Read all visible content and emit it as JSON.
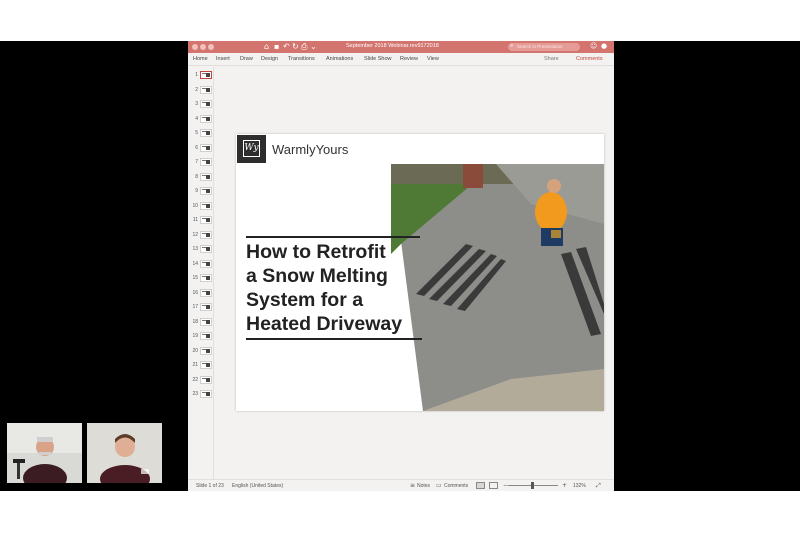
{
  "window": {
    "title": "September 2018 Webinar.rev9172018",
    "search_placeholder": "Search in Presentation",
    "icons": [
      "home-icon",
      "save-icon",
      "undo-icon",
      "redo-icon",
      "print-icon",
      "dropdown-icon",
      "search-icon",
      "smiley-icon",
      "user-icon"
    ]
  },
  "ribbon": {
    "tabs": [
      "Home",
      "Insert",
      "Draw",
      "Design",
      "Transitions",
      "Animations",
      "Slide Show",
      "Review",
      "View"
    ],
    "share_label": "Share",
    "comments_label": "Comments"
  },
  "thumbnails": {
    "numbers": [
      "1",
      "2",
      "3",
      "4",
      "5",
      "6",
      "7",
      "8",
      "9",
      "10",
      "11",
      "12",
      "13",
      "14",
      "15",
      "16",
      "17",
      "18",
      "19",
      "20",
      "21",
      "22",
      "23"
    ],
    "selected_index": 0
  },
  "slide": {
    "logo_mark": "Wy",
    "brand": "WarmlyYours",
    "headline_lines": [
      "How to Retrofit",
      "a Snow Melting",
      "System for a",
      "Heated Driveway"
    ]
  },
  "status": {
    "slide_counter": "Slide 1 of 23",
    "language": "English (United States)",
    "notes_label": "Notes",
    "comments_label": "Comments",
    "zoom": "132%"
  },
  "colors": {
    "titlebar": "#d3746f",
    "accent": "#c4443e",
    "slide_text": "#222222"
  }
}
